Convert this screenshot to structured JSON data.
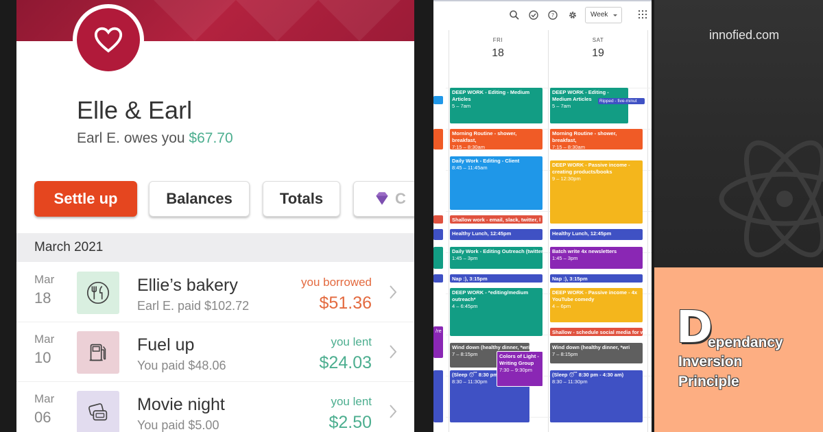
{
  "splitwise": {
    "group_name": "Elle & Earl",
    "owes_prefix": "Earl E. owes you ",
    "owes_amount": "$67.70",
    "buttons": {
      "settle": "Settle up",
      "balances": "Balances",
      "totals": "Totals",
      "premium": "C"
    },
    "month": "March 2021",
    "expenses": [
      {
        "month": "Mar",
        "day": "18",
        "title": "Ellie’s bakery",
        "subtitle": "Earl E. paid $102.72",
        "status": "you borrowed",
        "amount": "$51.36",
        "icon": "fork-knife-icon"
      },
      {
        "month": "Mar",
        "day": "10",
        "title": "Fuel up",
        "subtitle": "You paid $48.06",
        "status": "you lent",
        "amount": "$24.03",
        "icon": "fuel-pump-icon"
      },
      {
        "month": "Mar",
        "day": "06",
        "title": "Movie night",
        "subtitle": "You paid $5.00",
        "status": "you lent",
        "amount": "$2.50",
        "icon": "tickets-icon"
      }
    ],
    "colors": {
      "brand": "#b11a3a",
      "settle": "#e5461f",
      "lent": "#4cae8f",
      "borrowed": "#e36a3f"
    }
  },
  "calendar": {
    "view_select": "Week",
    "toolbar_icons": [
      "search-icon",
      "tasks-icon",
      "help-icon",
      "settings-icon",
      "apps-grid-icon"
    ],
    "days": [
      {
        "name": "FRI",
        "date": "18"
      },
      {
        "name": "SAT",
        "date": "19"
      }
    ],
    "fri_events": [
      {
        "title": "DEEP WORK - Editing - Medium Articles",
        "time": "5 – 7am",
        "color": "#129d84"
      },
      {
        "title": "Morning Routine - shower, breakfast,",
        "time": "7:15 – 8:30am",
        "color": "#f05b26"
      },
      {
        "title": "Daily Work - Editing - Client",
        "time": "8:45 – 11:45am",
        "color": "#1f97e8"
      },
      {
        "title": "Shallow work - email, slack, twitter, l",
        "time": "",
        "color": "#e0523f"
      },
      {
        "title": "Healthy Lunch, 12:45pm",
        "time": "",
        "color": "#3f51c4"
      },
      {
        "title": "Daily Work - Editing Outreach (twitter,",
        "time": "1:45 – 3pm",
        "color": "#129d84"
      },
      {
        "title": "Nap :), 3:15pm",
        "time": "",
        "color": "#3f51c4"
      },
      {
        "title": "DEEP WORK - *editing/medium outreach*",
        "time": "4 – 6:45pm",
        "color": "#129d84"
      },
      {
        "title": "Wind down (healthy dinner, *wri",
        "time": "7 – 8:15pm",
        "color": "#5f5f5f"
      },
      {
        "title": "Colors of Light - Writing Group",
        "time": "7:30 – 9:30pm",
        "color": "#8a27b4"
      },
      {
        "title": "(Sleep 😴 8:30 pm",
        "time": "8:30 – 11:30pm",
        "color": "#3f51c4"
      }
    ],
    "sat_events": [
      {
        "title": "DEEP WORK - Editing - Medium Articles",
        "time": "5 – 7am",
        "color": "#129d84"
      },
      {
        "title": "Ripped - five-minut",
        "time": "",
        "color": "#3f51c4"
      },
      {
        "title": "Morning Routine - shower, breakfast,",
        "time": "7:15 – 8:30am",
        "color": "#f05b26"
      },
      {
        "title": "DEEP WORK - Passive income - creating products/books",
        "time": "9 – 12:30pm",
        "color": "#f4b61c"
      },
      {
        "title": "Healthy Lunch, 12:45pm",
        "time": "",
        "color": "#3f51c4"
      },
      {
        "title": "Batch write 4x newsletters",
        "time": "1:45 – 3pm",
        "color": "#8a27b4"
      },
      {
        "title": "Nap :), 3:15pm",
        "time": "",
        "color": "#3f51c4"
      },
      {
        "title": "DEEP WORK - Passive income - 4x YouTube comedy",
        "time": "4 – 6pm",
        "color": "#f4b61c"
      },
      {
        "title": "Shallow - schedule social media for w",
        "time": "",
        "color": "#e0523f"
      },
      {
        "title": "Wind down (healthy dinner, *wri",
        "time": "7 – 8:15pm",
        "color": "#5f5f5f"
      },
      {
        "title": "(Sleep 😴 8:30 pm - 4:30 am)",
        "time": "8:30 – 11:30pm",
        "color": "#3f51c4"
      }
    ],
    "left_edge_label": "/re"
  },
  "brand": {
    "site": "innofied.com",
    "big_letter": "D",
    "title_line1_rest": "ependancy",
    "title_line2": "Inversion",
    "title_line3": "Principle",
    "colors": {
      "panel": "#fdae82",
      "dark": "#2a2a2a"
    }
  }
}
